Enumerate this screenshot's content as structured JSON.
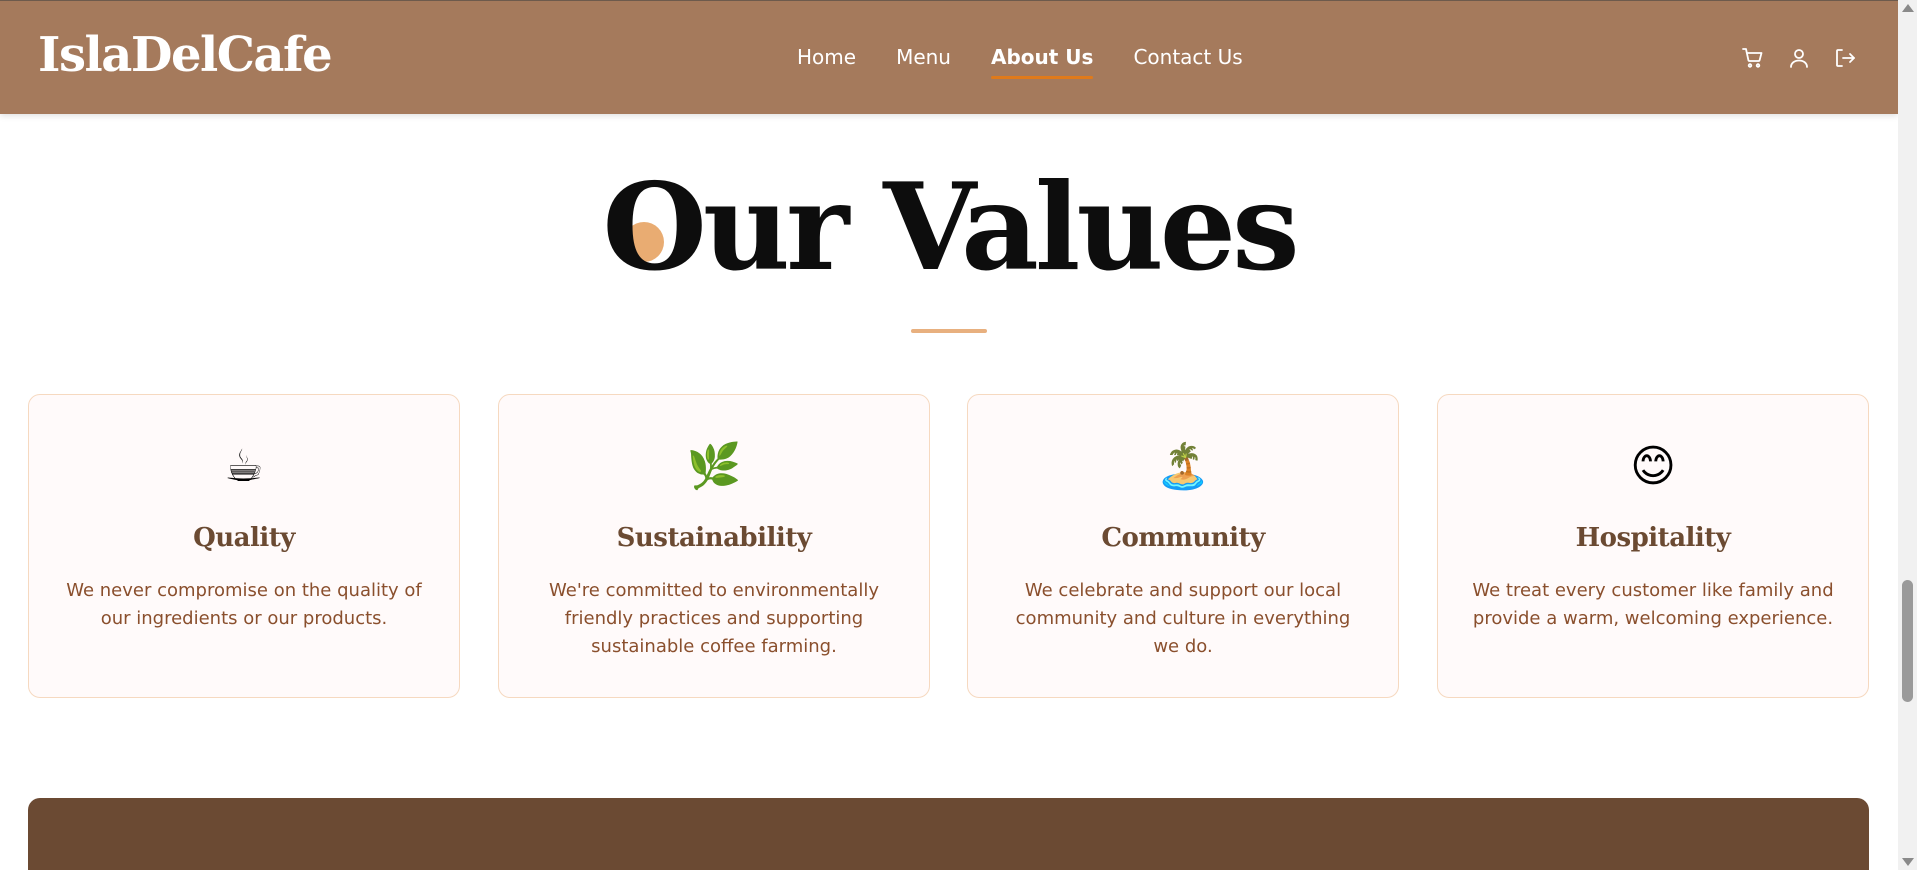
{
  "header": {
    "logo": "IslaDelCafe",
    "nav": [
      {
        "label": "Home",
        "active": false
      },
      {
        "label": "Menu",
        "active": false
      },
      {
        "label": "About Us",
        "active": true
      },
      {
        "label": "Contact Us",
        "active": false
      }
    ],
    "icons": [
      "cart-icon",
      "user-icon",
      "logout-icon"
    ]
  },
  "values": {
    "title": "Our Values",
    "cards": [
      {
        "icon": "☕",
        "icon_name": "coffee-cup-icon",
        "title": "Quality",
        "text": "We never compromise on the quality of our ingredients or our products."
      },
      {
        "icon": "🌿",
        "icon_name": "herb-leaf-icon",
        "title": "Sustainability",
        "text": "We're committed to environmentally friendly practices and supporting sustainable coffee farming."
      },
      {
        "icon": "🏝️",
        "icon_name": "island-palm-icon",
        "title": "Community",
        "text": "We celebrate and support our local community and culture in everything we do."
      },
      {
        "icon": "😊",
        "icon_name": "smiling-face-icon",
        "title": "Hospitality",
        "text": "We treat every customer like family and provide a warm, welcoming experience."
      }
    ]
  },
  "colors": {
    "header_bg": "#a57a5c",
    "accent": "#e9ac72",
    "nav_active_underline": "#e07a1a",
    "card_title": "#6b4a32",
    "card_text": "#8a4f2d",
    "bottom_band": "#6b4a33"
  }
}
